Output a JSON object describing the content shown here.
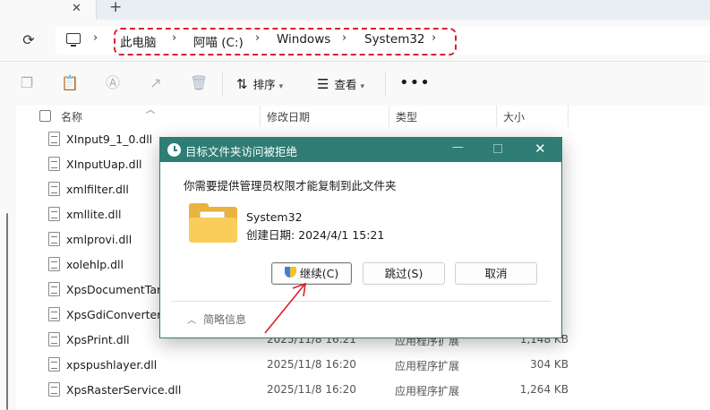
{
  "tabbar": {
    "close_glyph": "✕",
    "new_tab_glyph": "+"
  },
  "address": {
    "breadcrumbs": [
      "此电脑",
      "阿喵 (C:)",
      "Windows",
      "System32"
    ],
    "separator": "›",
    "highlight_color": "#d9202c"
  },
  "toolbar": {
    "sort_label": "排序",
    "view_label": "查看",
    "more_label": "•••"
  },
  "columns": {
    "name": "名称",
    "date": "修改日期",
    "type": "类型",
    "size": "大小"
  },
  "files": [
    {
      "name": "XInput9_1_0.dll",
      "date": "",
      "type": "",
      "size": ""
    },
    {
      "name": "XInputUap.dll",
      "date": "",
      "type": "",
      "size": ""
    },
    {
      "name": "xmlfilter.dll",
      "date": "",
      "type": "",
      "size": ""
    },
    {
      "name": "xmllite.dll",
      "date": "",
      "type": "",
      "size": ""
    },
    {
      "name": "xmlprovi.dll",
      "date": "",
      "type": "",
      "size": ""
    },
    {
      "name": "xolehlp.dll",
      "date": "",
      "type": "",
      "size": ""
    },
    {
      "name": "XpsDocumentTarg",
      "date": "",
      "type": "",
      "size": ""
    },
    {
      "name": "XpsGdiConverter.c",
      "date": "",
      "type": "",
      "size": ""
    },
    {
      "name": "XpsPrint.dll",
      "date": "2025/11/8 16:21",
      "type": "应用程序扩展",
      "size": "1,148 KB"
    },
    {
      "name": "xpspushlayer.dll",
      "date": "2025/11/8 16:20",
      "type": "应用程序扩展",
      "size": "304 KB"
    },
    {
      "name": "XpsRasterService.dll",
      "date": "2025/11/8 16:20",
      "type": "应用程序扩展",
      "size": "1,264 KB"
    }
  ],
  "dialog": {
    "title": "目标文件夹访问被拒绝",
    "message": "你需要提供管理员权限才能复制到此文件夹",
    "item_name": "System32",
    "item_date": "创建日期: 2024/4/1 15:21",
    "continue_label": "继续(C)",
    "skip_label": "跳过(S)",
    "cancel_label": "取消",
    "details_label": "简略信息",
    "title_color": "#2f7d74"
  }
}
